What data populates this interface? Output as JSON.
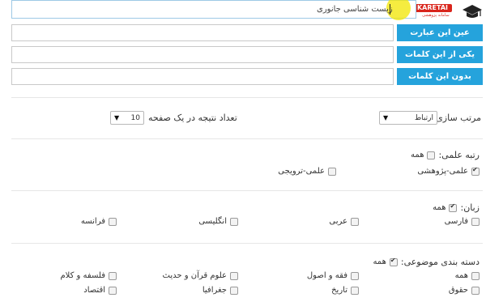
{
  "search": {
    "main_value": "زیست شناسی جانوری",
    "exact_label": "عین این عبارت",
    "any_label": "یکی از این کلمات",
    "without_label": "بدون این کلمات"
  },
  "logo": {
    "text": "KARETAI",
    "sub": "سامانه پژوهشی"
  },
  "sort": {
    "label": "مرتب سازی:",
    "value": "ارتباط",
    "per_page_label": "تعداد نتیجه در یک صفحه",
    "per_page_value": "10"
  },
  "rank": {
    "label": "رتبه علمی:",
    "all": "همه",
    "options": [
      "علمی-پژوهشی",
      "علمی-ترویجی"
    ]
  },
  "language": {
    "label": "زبان:",
    "all": "همه",
    "options": [
      "فارسی",
      "عربی",
      "انگلیسی",
      "فرانسه"
    ]
  },
  "category": {
    "label": "دسته بندی موضوعی:",
    "all": "همه",
    "row1": [
      "همه",
      "فقه و اصول",
      "علوم قرآن و حدیث",
      "فلسفه و کلام"
    ],
    "row2": [
      "حقوق",
      "تاریخ",
      "جغرافیا",
      "اقتصاد"
    ]
  },
  "colors": {
    "accent": "#25a3dc",
    "logo_red": "#d9251c",
    "cursor_highlight": "#f2e600"
  }
}
